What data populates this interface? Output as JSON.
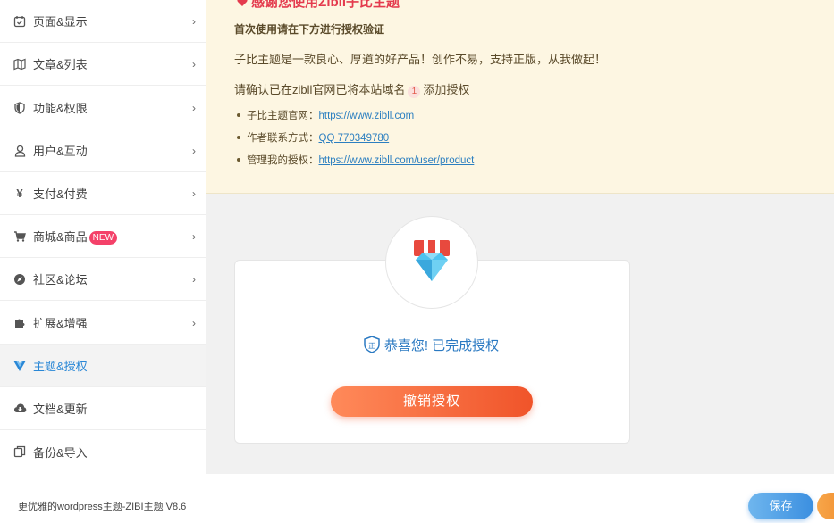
{
  "sidebar": {
    "items": [
      {
        "label": "页面&显示",
        "icon": "calendar-check-icon",
        "chevron": "›"
      },
      {
        "label": "文章&列表",
        "icon": "map-icon",
        "chevron": "›"
      },
      {
        "label": "功能&权限",
        "icon": "shield-icon",
        "chevron": "›"
      },
      {
        "label": "用户&互动",
        "icon": "user-icon",
        "chevron": "›"
      },
      {
        "label": "支付&付费",
        "icon": "yen-icon",
        "chevron": "›"
      },
      {
        "label": "商城&商品",
        "icon": "cart-icon",
        "chevron": "›",
        "badge": "NEW"
      },
      {
        "label": "社区&论坛",
        "icon": "compass-icon",
        "chevron": "›"
      },
      {
        "label": "扩展&增强",
        "icon": "puzzle-icon",
        "chevron": "›"
      },
      {
        "label": "主题&授权",
        "icon": "vue-logo-icon",
        "active": true
      },
      {
        "label": "文档&更新",
        "icon": "cloud-download-icon"
      },
      {
        "label": "备份&导入",
        "icon": "copy-icon"
      }
    ]
  },
  "notice": {
    "title": "感谢您使用Zibll子比主题",
    "subtitle": "首次使用请在下方进行授权验证",
    "line1": "子比主题是一款良心、厚道的好产品！创作不易，支持正版，从我做起！",
    "line2_pre": "请确认已在zibll官网已将本站域名",
    "line2_badge": "1",
    "line2_post": "添加授权",
    "links": [
      {
        "label": "子比主题官网：",
        "text": "https://www.zibll.com"
      },
      {
        "label": "作者联系方式：",
        "text": "QQ 770349780"
      },
      {
        "label": "管理我的授权：",
        "text": "https://www.zibll.com/user/product"
      }
    ]
  },
  "auth": {
    "status_text": "恭喜您! 已完成授权",
    "shield_char": "正",
    "revoke_label": "撤销授权"
  },
  "footer": {
    "version_text": "更优雅的wordpress主题-ZIBI主题 V8.6",
    "save_label": "保存"
  },
  "colors": {
    "accent_blue": "#2a79c2",
    "active_blue": "#2987d6",
    "notice_bg": "#fdf6e2",
    "revoke_orange": "#f0542a",
    "badge_red": "#f44169"
  }
}
